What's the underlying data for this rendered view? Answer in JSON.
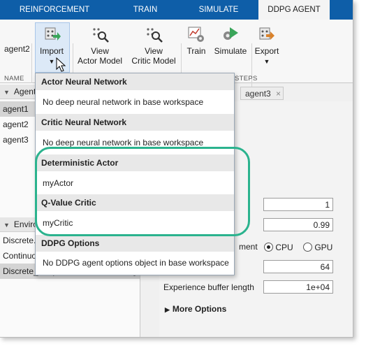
{
  "tabs": [
    "REINFORCEMENT LEARNING",
    "TRAIN",
    "SIMULATE",
    "DDPG AGENT"
  ],
  "agent_label": "agent2",
  "name_section_label": "NAME",
  "toolstrip": {
    "import": {
      "label": "Import",
      "arrow": "▼"
    },
    "view_actor": {
      "line1": "View",
      "line2": "Actor Model"
    },
    "view_critic": {
      "line1": "View",
      "line2": "Critic Model"
    },
    "train": "Train",
    "simulate": "Simulate",
    "export": {
      "label": "Export",
      "arrow": "▼"
    },
    "steps_section_label": "STEPS"
  },
  "agents_panel": {
    "header": "Agents",
    "items": [
      "agent1",
      "agent2",
      "agent3"
    ]
  },
  "environments_panel": {
    "header": "Environments",
    "items": [
      "Discrete...",
      "Continuous...",
      "Discrete_SimplePendulumWithImage..."
    ]
  },
  "document_tabs": {
    "tab": "agent3",
    "close": "×"
  },
  "settings": {
    "field1": "1",
    "field2": "0.99",
    "environment_label": "ment",
    "cpu": "CPU",
    "gpu": "GPU",
    "field3": "64",
    "buffer_label": "Experience buffer length",
    "buffer_value": "1e+04",
    "more_options": "More Options"
  },
  "dropdown": {
    "sections": [
      {
        "header": "Actor Neural Network",
        "item": "No deep neural network in base workspace"
      },
      {
        "header": "Critic Neural Network",
        "item": "No deep neural network in base workspace"
      },
      {
        "header": "Deterministic Actor",
        "item": "myActor"
      },
      {
        "header": "Q-Value Critic",
        "item": "myCritic"
      },
      {
        "header": "DDPG Options",
        "item": "No DDPG agent options object in base workspace"
      }
    ]
  },
  "colors": {
    "tabbar": "#0e5ea8",
    "highlight": "#2bb38e"
  }
}
